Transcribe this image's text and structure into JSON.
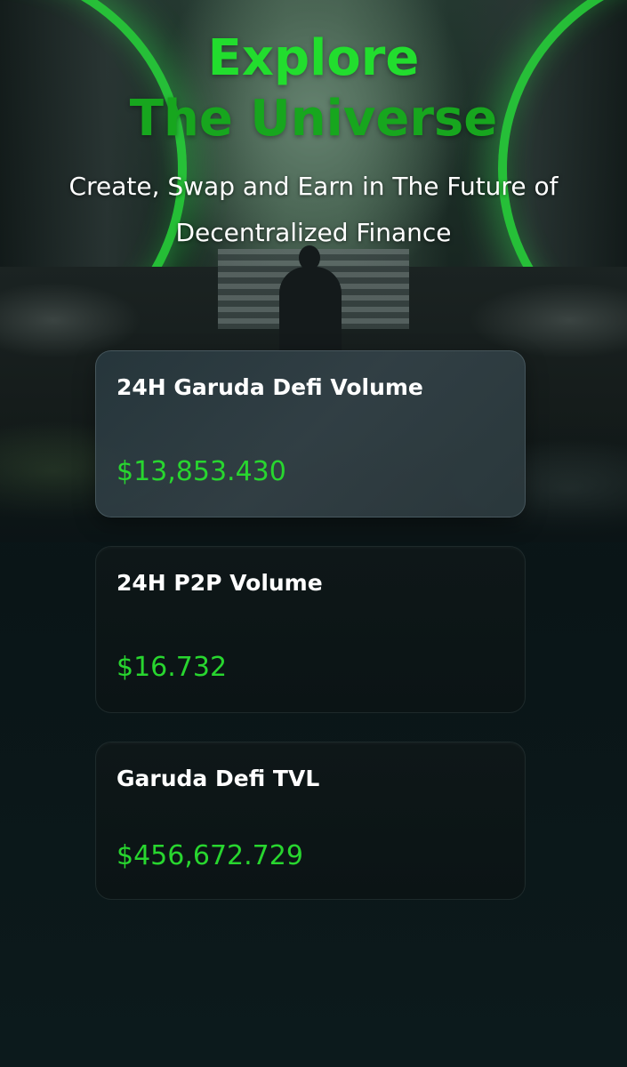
{
  "hero": {
    "headline_line1": "Explore",
    "headline_line2": "The Universe",
    "subtitle_line1": "Create, Swap and Earn in The Future of",
    "subtitle_line2": "Decentralized Finance",
    "accent_color": "#22dd2e"
  },
  "stats": [
    {
      "label": "24H Garuda Defi Volume",
      "value": "$13,853.430"
    },
    {
      "label": "24H P2P Volume",
      "value": "$16.732"
    },
    {
      "label": "Garuda Defi TVL",
      "value": "$456,672.729"
    }
  ],
  "colors": {
    "value_green": "#28d62f",
    "background": "#0b1416"
  }
}
